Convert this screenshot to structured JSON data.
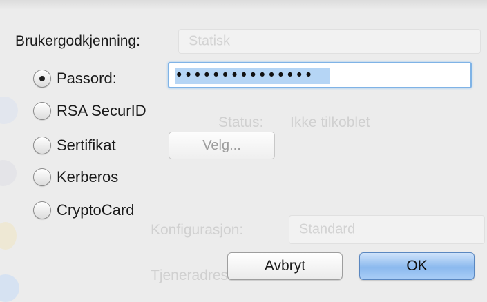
{
  "dialog": {
    "title": "Brukergodkjenning:"
  },
  "auth_options": [
    {
      "label": "Passord:",
      "checked": true
    },
    {
      "label": "RSA SecurID",
      "checked": false
    },
    {
      "label": "Sertifikat",
      "checked": false
    },
    {
      "label": "Kerberos",
      "checked": false
    },
    {
      "label": "CryptoCard",
      "checked": false
    }
  ],
  "password": {
    "value": "•••••••••••••••"
  },
  "certificate": {
    "choose_label": "Velg..."
  },
  "buttons": {
    "cancel_label": "Avbryt",
    "ok_label": "OK"
  },
  "background_window": {
    "dropdown_value": "Statisk",
    "status_label": "Status:",
    "status_value": "Ikke tilkoblet",
    "config_label": "Konfigurasjon:",
    "config_value": "Standard",
    "server_label": "Tjeneradresse:"
  },
  "colors": {
    "accent": "#8bb9ee",
    "focus_ring": "#7fb3e6",
    "selection": "#b5d5f5"
  }
}
